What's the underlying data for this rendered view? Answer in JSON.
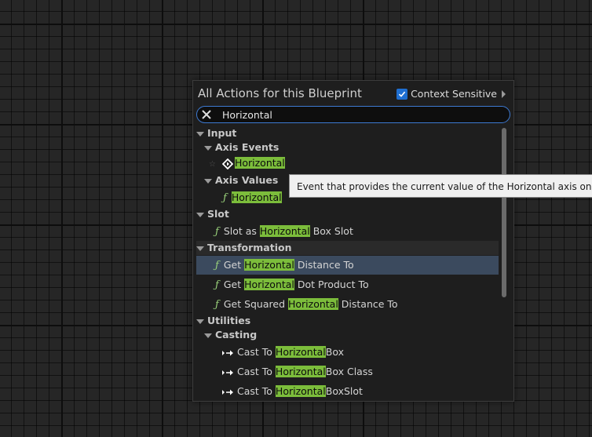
{
  "menu": {
    "title": "All Actions for this Blueprint",
    "context_sensitive": {
      "label": "Context Sensitive",
      "checked": true
    },
    "search": {
      "value": "Horizontal",
      "placeholder": ""
    }
  },
  "tooltip": {
    "text": "Event that provides the current value of the Horizontal axis once per fra"
  },
  "tree": {
    "input": "Input",
    "axis_events": "Axis Events",
    "axis_event_item": {
      "highlight": "Horizontal"
    },
    "axis_values": "Axis Values",
    "axis_value_item": {
      "highlight": "Horizontal"
    },
    "slot": "Slot",
    "slot_item": {
      "prefix": "Slot as ",
      "highlight": "Horizontal",
      "suffix": " Box Slot"
    },
    "transformation": "Transformation",
    "transformation_items": [
      {
        "prefix": "Get ",
        "highlight": "Horizontal",
        "suffix": " Distance To"
      },
      {
        "prefix": "Get ",
        "highlight": "Horizontal",
        "suffix": " Dot Product To"
      },
      {
        "prefix": "Get Squared ",
        "highlight": "Horizontal",
        "suffix": " Distance To"
      }
    ],
    "utilities": "Utilities",
    "casting": "Casting",
    "casting_items": [
      {
        "prefix": "Cast To ",
        "highlight": "Horizontal",
        "suffix": "Box"
      },
      {
        "prefix": "Cast To ",
        "highlight": "Horizontal",
        "suffix": "Box Class"
      },
      {
        "prefix": "Cast To ",
        "highlight": "Horizontal",
        "suffix": "BoxSlot"
      }
    ]
  },
  "colors": {
    "highlight": "#7cbd3b",
    "selection": "#3b4a5e",
    "checkbox": "#1f6fd1",
    "search_border": "#3d7ad3"
  },
  "icons": {
    "clear": "close-icon",
    "function": "function-icon",
    "event": "event-diamond-icon",
    "cast": "cast-arrow-icon",
    "favorite": "star-icon"
  }
}
